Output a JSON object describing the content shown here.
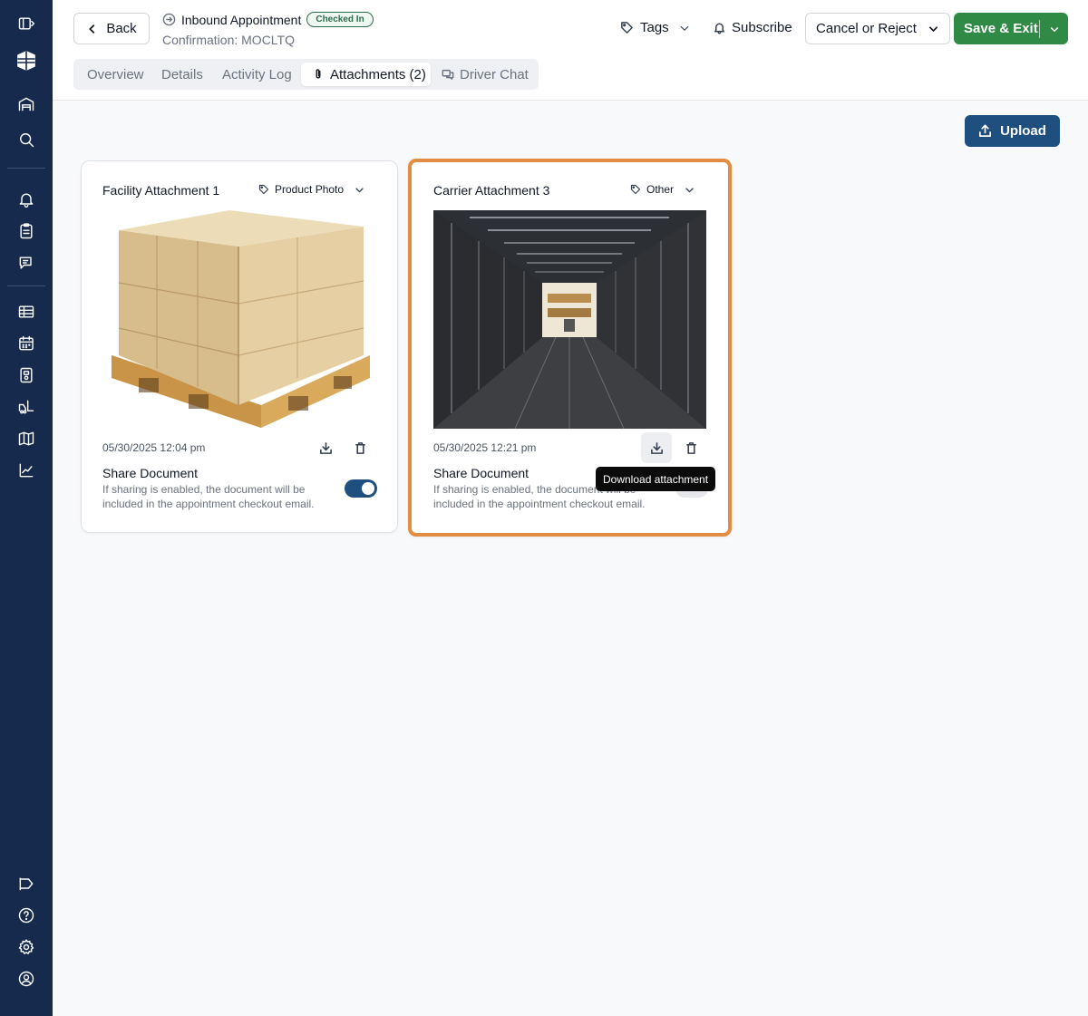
{
  "sidebar": {
    "items": [
      {
        "name": "sidebar-toggle-icon"
      },
      {
        "name": "app-logo-icon"
      },
      {
        "name": "warehouse-icon"
      },
      {
        "name": "search-icon"
      },
      {
        "name": "bell-icon"
      },
      {
        "name": "clipboard-icon"
      },
      {
        "name": "chat-icon"
      },
      {
        "name": "list-icon"
      },
      {
        "name": "calendar-icon"
      },
      {
        "name": "dock-icon"
      },
      {
        "name": "forklift-icon"
      },
      {
        "name": "map-icon"
      },
      {
        "name": "chart-icon"
      },
      {
        "name": "announcement-icon"
      },
      {
        "name": "help-icon"
      },
      {
        "name": "settings-icon"
      },
      {
        "name": "user-icon"
      }
    ]
  },
  "header": {
    "back_label": "Back",
    "title": "Inbound Appointment",
    "status": "Checked In",
    "confirmation": "Confirmation: MOCLTQ",
    "tags_label": "Tags",
    "subscribe_label": "Subscribe",
    "cancel_label": "Cancel or Reject",
    "save_label": "Save & Exit"
  },
  "tabs": [
    {
      "label": "Overview"
    },
    {
      "label": "Details"
    },
    {
      "label": "Activity Log"
    },
    {
      "label": "Attachments (2)"
    },
    {
      "label": "Driver Chat"
    }
  ],
  "active_tab": "Attachments (2)",
  "upload_label": "Upload",
  "attachments": [
    {
      "title": "Facility Attachment 1",
      "tag": "Product Photo",
      "date": "05/30/2025 12:04 pm",
      "share_title": "Share Document",
      "share_desc": "If sharing is enabled, the document will be included in the appointment checkout email.",
      "shared": true
    },
    {
      "title": "Carrier Attachment 3",
      "tag": "Other",
      "date": "05/30/2025 12:21 pm",
      "share_title": "Share Document",
      "share_desc": "If sharing is enabled, the document will be included in the appointment checkout email.",
      "shared": false
    }
  ],
  "tooltip": "Download attachment",
  "colors": {
    "sidebar": "#152a4d",
    "primary": "#1f4f7f",
    "save": "#2f8a45",
    "highlight": "#e38d43",
    "badge": "#2f6b48"
  }
}
